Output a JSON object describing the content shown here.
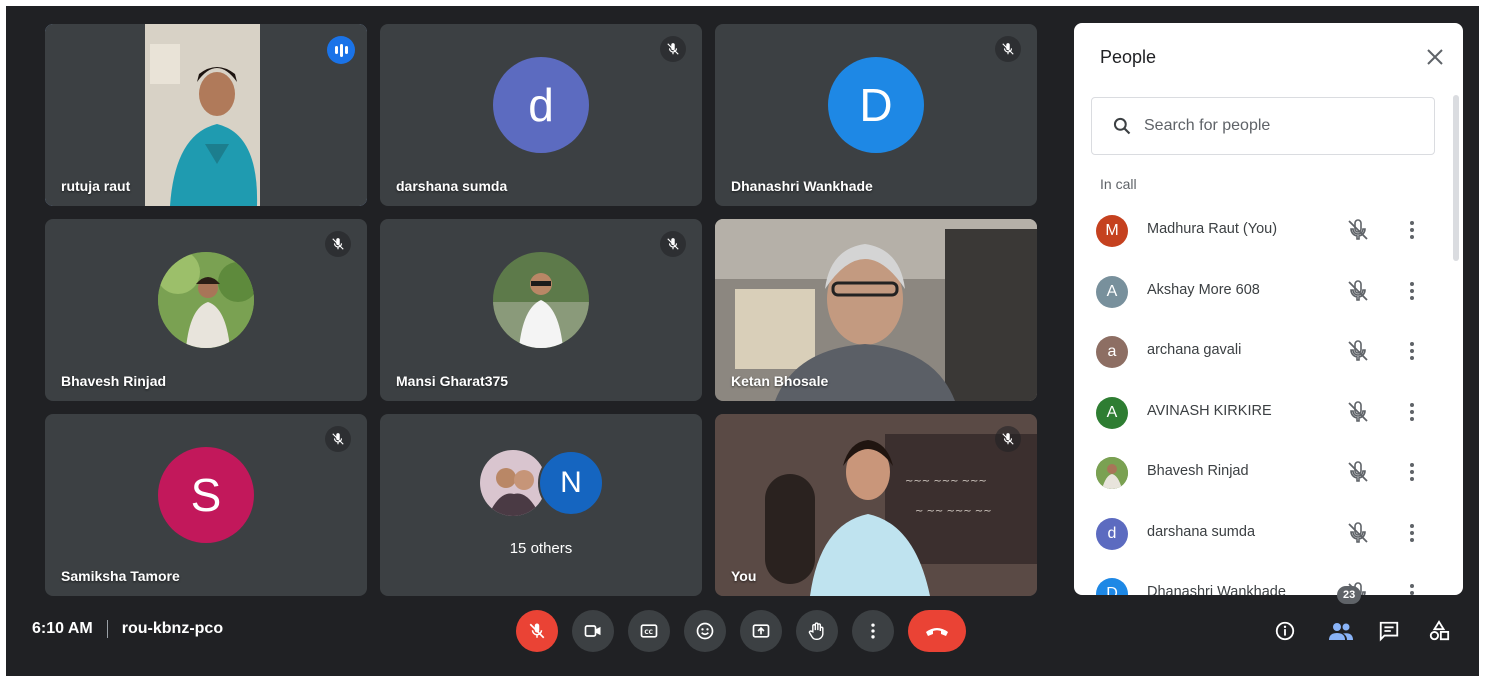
{
  "tiles": [
    {
      "name": "rutuja raut",
      "kind": "video",
      "speaking": true
    },
    {
      "name": "darshana sumda",
      "kind": "letter",
      "letter": "d",
      "color": "#5c6bc0",
      "muted": true
    },
    {
      "name": "Dhanashri Wankhade",
      "kind": "letter",
      "letter": "D",
      "color": "#1e88e5",
      "muted": true
    },
    {
      "name": "Bhavesh Rinjad",
      "kind": "photo",
      "muted": true
    },
    {
      "name": "Mansi Gharat375",
      "kind": "photo",
      "muted": true
    },
    {
      "name": "Ketan Bhosale",
      "kind": "video"
    },
    {
      "name": "Samiksha Tamore",
      "kind": "letter",
      "letter": "S",
      "color": "#c2185b",
      "muted": true
    },
    {
      "name": "15 others",
      "kind": "others",
      "letter": "N",
      "color": "#1565c0"
    },
    {
      "name": "You",
      "kind": "video",
      "muted": true
    }
  ],
  "meeting": {
    "time": "6:10 AM",
    "code": "rou-kbnz-pco"
  },
  "controls": [
    "mic-off",
    "camera",
    "captions",
    "emoji",
    "present",
    "raise-hand",
    "more",
    "leave"
  ],
  "right_controls": {
    "participant_count": "23",
    "icons": [
      "info",
      "people",
      "chat",
      "activities"
    ]
  },
  "panel": {
    "title": "People",
    "search_placeholder": "Search for people",
    "section": "In call",
    "participants": [
      {
        "name": "Madhura Raut (You)",
        "letter": "M",
        "color": "#c5411f"
      },
      {
        "name": "Akshay More 608",
        "letter": "A",
        "color": "#78909c"
      },
      {
        "name": "archana gavali",
        "letter": "a",
        "color": "#8d6e63"
      },
      {
        "name": "AVINASH KIRKIRE",
        "letter": "A",
        "color": "#2e7d32"
      },
      {
        "name": "Bhavesh Rinjad",
        "letter": "",
        "color": "#6b8e4e"
      },
      {
        "name": "darshana sumda",
        "letter": "d",
        "color": "#5c6bc0"
      },
      {
        "name": "Dhanashri Wankhade",
        "letter": "D",
        "color": "#1e88e5"
      }
    ]
  }
}
